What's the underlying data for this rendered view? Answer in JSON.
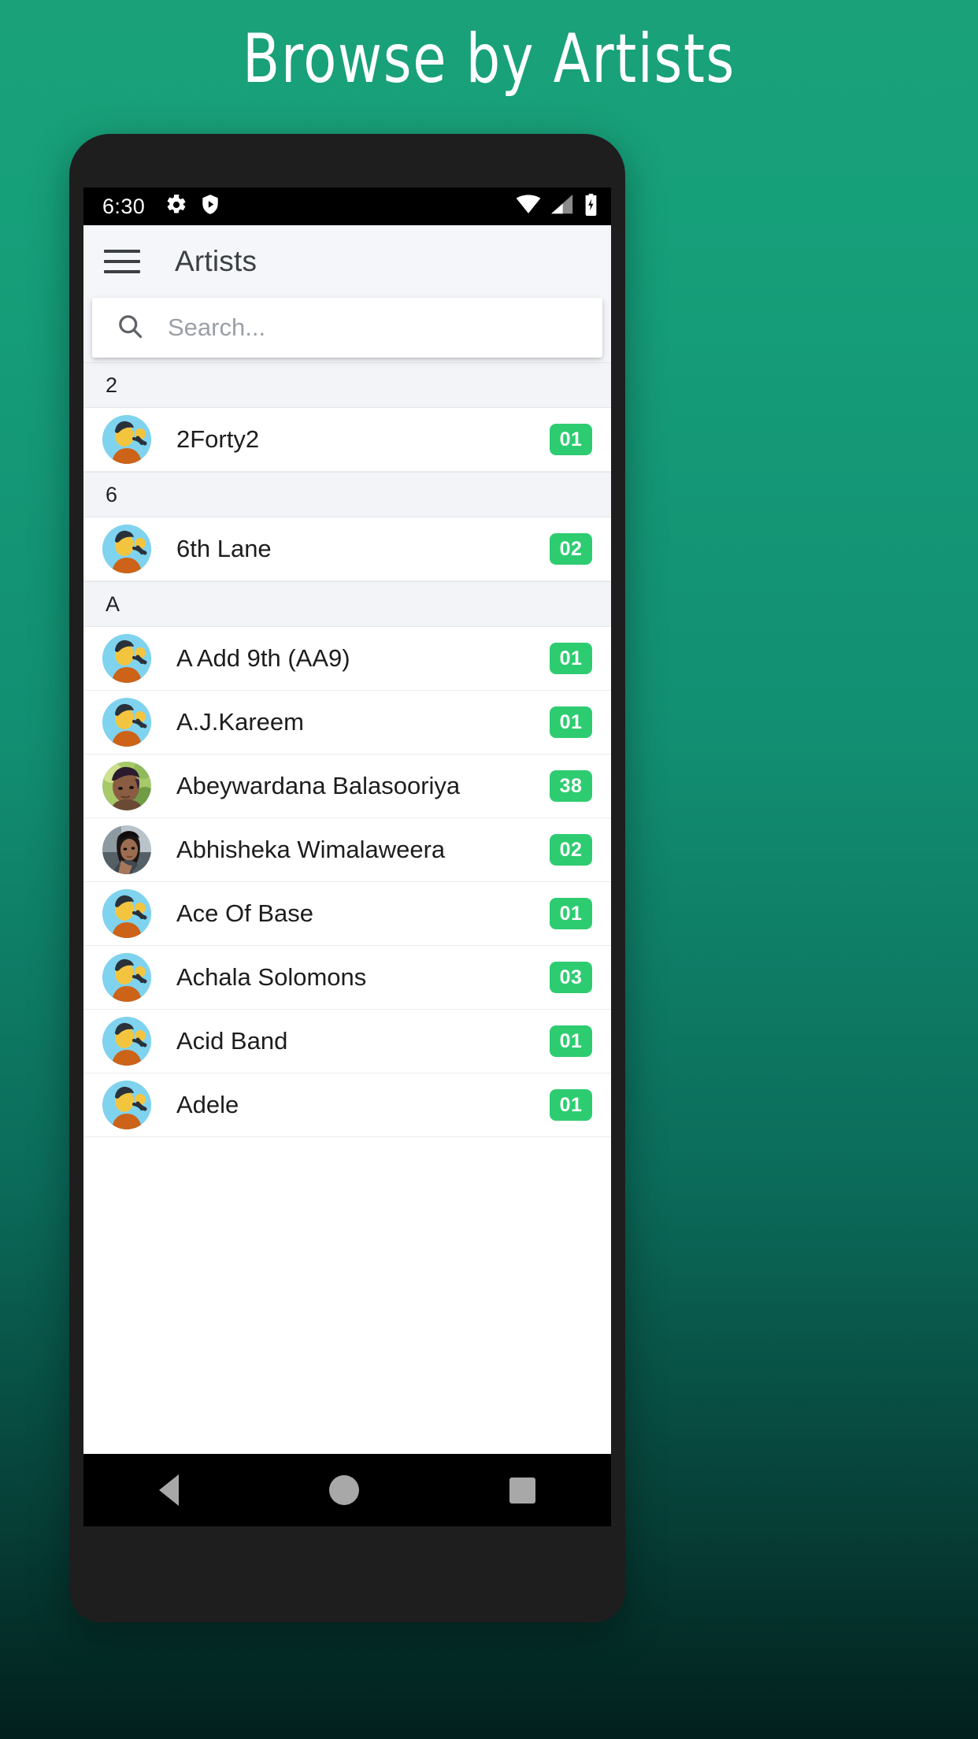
{
  "promo": {
    "title": "Browse by Artists"
  },
  "colors": {
    "background_top": "#1aa179",
    "background_bottom": "#02201d",
    "badge_green": "#2ecc71",
    "appbar_bg": "#f4f6f9",
    "section_header_bg": "#f2f4f7",
    "title_text": "#3c4043"
  },
  "statusbar": {
    "time": "6:30",
    "left_icons": [
      "gear-icon",
      "shield-play-icon"
    ],
    "right_icons": [
      "wifi-icon",
      "cell-signal-icon",
      "battery-charging-icon"
    ]
  },
  "appbar": {
    "menu_icon": "hamburger-menu-icon",
    "title": "Artists"
  },
  "search": {
    "icon": "search-icon",
    "value": "",
    "placeholder": "Search..."
  },
  "sections": [
    {
      "header": "2",
      "items": [
        {
          "name": "2Forty2",
          "count": "01",
          "avatar": "default"
        }
      ]
    },
    {
      "header": "6",
      "items": [
        {
          "name": "6th Lane",
          "count": "02",
          "avatar": "default"
        }
      ]
    },
    {
      "header": "A",
      "items": [
        {
          "name": "A Add 9th (AA9)",
          "count": "01",
          "avatar": "default"
        },
        {
          "name": "A.J.Kareem",
          "count": "01",
          "avatar": "default"
        },
        {
          "name": "Abeywardana Balasooriya",
          "count": "38",
          "avatar": "photo-man"
        },
        {
          "name": "Abhisheka Wimalaweera",
          "count": "02",
          "avatar": "photo-woman"
        },
        {
          "name": "Ace Of Base",
          "count": "01",
          "avatar": "default"
        },
        {
          "name": "Achala Solomons",
          "count": "03",
          "avatar": "default"
        },
        {
          "name": "Acid Band",
          "count": "01",
          "avatar": "default"
        },
        {
          "name": "Adele",
          "count": "01",
          "avatar": "default"
        }
      ]
    }
  ],
  "navbar": {
    "back_label": "Back",
    "home_label": "Home",
    "recent_label": "Recent apps"
  }
}
